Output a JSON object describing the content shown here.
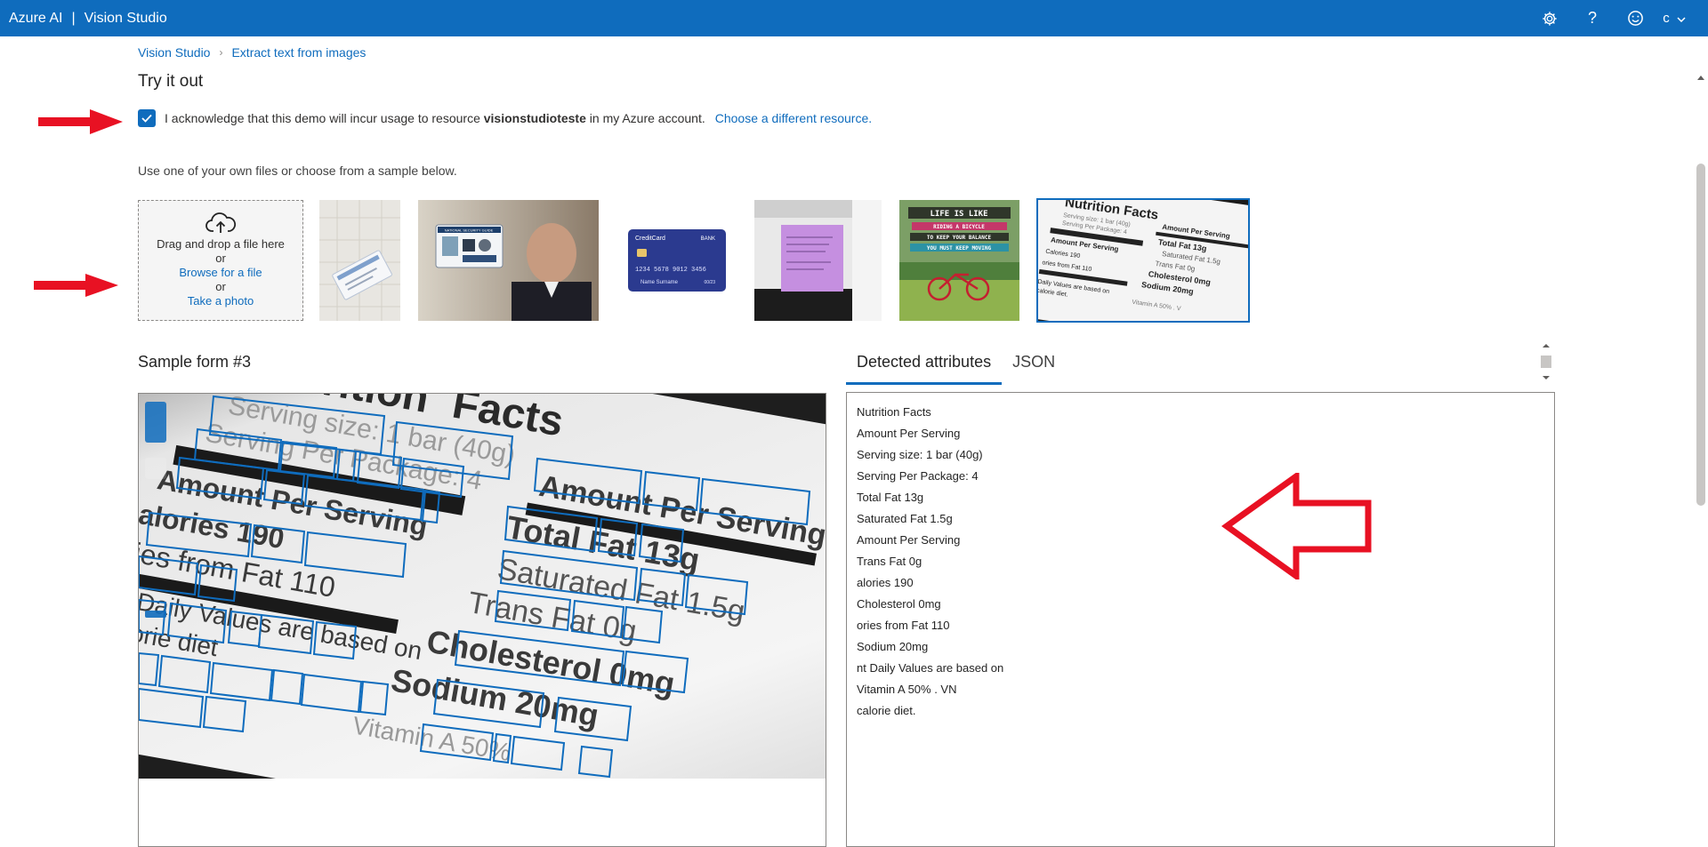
{
  "app": {
    "brand": "Azure AI",
    "product": "Vision Studio",
    "user_initial": "c"
  },
  "topbar": {
    "icons": [
      "settings-icon",
      "help-icon",
      "feedback-smiley-icon",
      "chevron-down-icon"
    ]
  },
  "breadcrumb": {
    "items": [
      "Vision Studio",
      "Extract text from images"
    ]
  },
  "section": {
    "title": "Try it out"
  },
  "acknowledge": {
    "checked": true,
    "prefix": "I acknowledge that this demo will incur usage to resource ",
    "resource": "visionstudioteste",
    "suffix": " in my Azure account.",
    "link": "Choose a different resource."
  },
  "upload": {
    "instruction": "Use one of your own files or choose from a sample below.",
    "drag_text": "Drag and drop a file here",
    "or1": "or",
    "browse": "Browse for a file",
    "or2": "or",
    "photo": "Take a photo"
  },
  "samples": [
    {
      "name": "social-security-card"
    },
    {
      "name": "man-holding-id-card",
      "card_title": "NATIONAL SECURITY GUIDE"
    },
    {
      "name": "credit-card",
      "brand": "CreditCard",
      "bank": "BANK",
      "number": "1234 5678 9012 3456",
      "holder": "Name Surname",
      "exp": "00/23"
    },
    {
      "name": "sticky-note"
    },
    {
      "name": "bicycle-poster",
      "l1": "LIFE IS LIKE",
      "l2": "RIDING A BICYCLE",
      "l3": "TO KEEP YOUR BALANCE",
      "l4": "YOU MUST KEEP MOVING"
    },
    {
      "name": "nutrition-facts",
      "selected": true
    }
  ],
  "sample_form": {
    "title": "Sample form #3"
  },
  "tabs": [
    {
      "label": "Detected attributes",
      "active": true
    },
    {
      "label": "JSON",
      "active": false
    }
  ],
  "detected_lines": [
    "Nutrition Facts",
    "Amount Per Serving",
    "Serving size: 1 bar (40g)",
    "Serving Per Package: 4",
    "Total Fat 13g",
    "Saturated Fat 1.5g",
    "Amount Per Serving",
    "Trans Fat 0g",
    "alories 190",
    "Cholesterol 0mg",
    "ories from Fat 110",
    "Sodium 20mg",
    "nt Daily Values are based on",
    "Vitamin A 50% . VN",
    "calorie diet."
  ],
  "image_words": {
    "nutrition": "Nutrition",
    "facts": "Facts",
    "serving_size": "Serving size: 1 bar (40g)",
    "serving_pkg": "Serving Per Package: 4",
    "amount": "Amount Per Serving",
    "amount2": "Amount Per Serving",
    "total_fat": "Total Fat 13g",
    "calories": "alories 190",
    "saturated": "Saturated Fat 1.5g",
    "trans": "Trans Fat 0g",
    "from_fat": "ries from Fat 110",
    "cholesterol": "Cholesterol 0mg",
    "daily": "nt Daily Values are based on",
    "sodium": "Sodium 20mg",
    "calorie_diet": "calorie diet",
    "vitamin": "Vitamin A 50%",
    "thumb_title": "Nutrition Facts",
    "thumb_amount": "Amount Per Serving",
    "thumb_serving": "Serving size: 1 bar (40g)",
    "thumb_pkg": "Serving Per Package: 4",
    "thumb_total": "Total Fat 13g",
    "thumb_sat": "Saturated Fat 1.5g",
    "thumb_trans": "Trans Fat 0g",
    "thumb_amount2": "Amount Per Serving",
    "thumb_cal": "Calories 190",
    "thumb_chol": "Cholesterol 0mg",
    "thumb_from": "ories from Fat 110",
    "thumb_sodium": "Sodium 20mg",
    "thumb_daily": "Daily Values are based on",
    "thumb_diet": "calorie diet.",
    "thumb_vit": "Vitamin A 50% . V"
  },
  "colors": {
    "accent": "#0f6cbd",
    "annotation_arrow": "#e81123",
    "box": "#0f6cbd"
  }
}
